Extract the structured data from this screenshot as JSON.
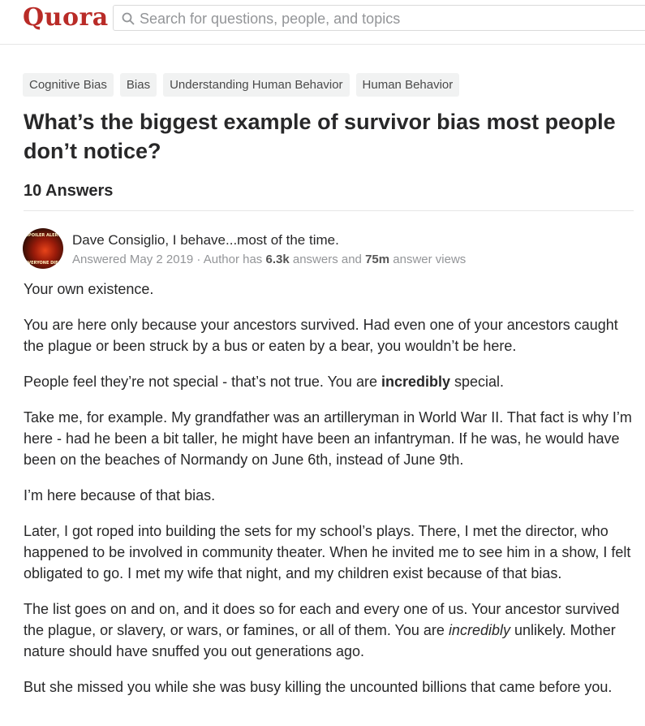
{
  "header": {
    "logo": "Quora",
    "search_placeholder": "Search for questions, people, and topics"
  },
  "tags": [
    "Cognitive Bias",
    "Bias",
    "Understanding Human Behavior",
    "Human Behavior"
  ],
  "question": {
    "title": "What’s the biggest example of survivor bias most people don’t notice?",
    "answer_count": "10 Answers"
  },
  "answer": {
    "author_line": "Dave Consiglio, I behave...most of the time.",
    "avatar_text_top": "SPOILER ALERT",
    "avatar_text_bottom": "EVERYONE DIES",
    "meta": {
      "answered": "Answered May 2 2019 · Author has ",
      "answers_count": "6.3k",
      "answers_label": " answers and ",
      "views_count": "75m",
      "views_label": " answer views"
    },
    "paragraphs": {
      "p1": "Your own existence.",
      "p2": "You are here only because your ancestors survived. Had even one of your ancestors caught the plague or been struck by a bus or eaten by a bear, you wouldn’t be here.",
      "p3a": "People feel they’re not special - that’s not true. You are ",
      "p3b": "incredibly",
      "p3c": " special.",
      "p4": "Take me, for example. My grandfather was an artilleryman in World War II. That fact is why I’m here - had he been a bit taller, he might have been an infantryman. If he was, he would have been on the beaches of Normandy on June 6th, instead of June 9th.",
      "p5": "I’m here because of that bias.",
      "p6": "Later, I got roped into building the sets for my school’s plays. There, I met the director, who happened to be involved in community theater. When he invited me to see him in a show, I felt obligated to go. I met my wife that night, and my children exist because of that bias.",
      "p7a": "The list goes on and on, and it does so for each and every one of us. Your ancestor survived the plague, or slavery, or wars, or famines, or all of them. You are ",
      "p7b": "incredibly",
      "p7c": " unlikely. Mother nature should have snuffed you out generations ago.",
      "p8": "But she missed you while she was busy killing the uncounted billions that came before you."
    }
  },
  "colors": {
    "brand": "#b92b27",
    "text": "#282829",
    "muted": "#939598",
    "tag_bg": "#f1f2f2"
  },
  "icons": {
    "search": "search-icon"
  }
}
